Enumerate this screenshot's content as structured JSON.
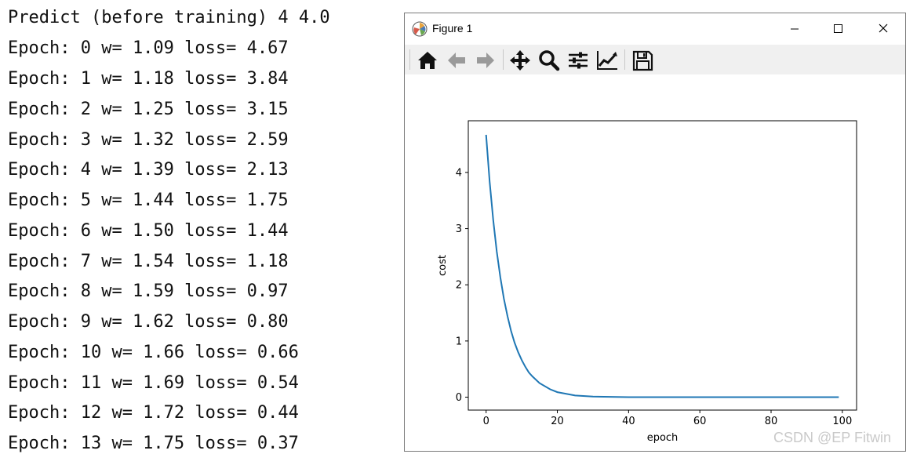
{
  "console": {
    "lines": [
      "Predict (before training) 4 4.0",
      "Epoch: 0 w= 1.09 loss= 4.67",
      "Epoch: 1 w= 1.18 loss= 3.84",
      "Epoch: 2 w= 1.25 loss= 3.15",
      "Epoch: 3 w= 1.32 loss= 2.59",
      "Epoch: 4 w= 1.39 loss= 2.13",
      "Epoch: 5 w= 1.44 loss= 1.75",
      "Epoch: 6 w= 1.50 loss= 1.44",
      "Epoch: 7 w= 1.54 loss= 1.18",
      "Epoch: 8 w= 1.59 loss= 0.97",
      "Epoch: 9 w= 1.62 loss= 0.80",
      "Epoch: 10 w= 1.66 loss= 0.66",
      "Epoch: 11 w= 1.69 loss= 0.54",
      "Epoch: 12 w= 1.72 loss= 0.44",
      "Epoch: 13 w= 1.75 loss= 0.37"
    ]
  },
  "window": {
    "title": "Figure 1",
    "controls": [
      "minimize-icon",
      "maximize-icon",
      "close-icon"
    ]
  },
  "toolbar": {
    "tools": [
      "home-icon",
      "back-icon",
      "forward-icon",
      "pan-icon",
      "zoom-icon",
      "configure-subplots-icon",
      "edit-axis-icon",
      "save-icon"
    ]
  },
  "chart_data": {
    "type": "line",
    "xlabel": "epoch",
    "ylabel": "cost",
    "xlim": [
      -5,
      104
    ],
    "ylim": [
      -0.23,
      4.92
    ],
    "xticks": [
      0,
      20,
      40,
      60,
      80,
      100
    ],
    "yticks": [
      0,
      1,
      2,
      3,
      4
    ],
    "grid": false,
    "line_color": "#1f77b4",
    "series": [
      {
        "x": [
          0,
          1,
          2,
          3,
          4,
          5,
          6,
          7,
          8,
          9,
          10,
          11,
          12,
          13,
          15,
          18,
          20,
          25,
          30,
          40,
          50,
          60,
          70,
          80,
          90,
          99
        ],
        "values": [
          4.67,
          3.84,
          3.15,
          2.59,
          2.13,
          1.75,
          1.44,
          1.18,
          0.97,
          0.8,
          0.66,
          0.54,
          0.44,
          0.37,
          0.25,
          0.14,
          0.09,
          0.03,
          0.01,
          0.0,
          0.0,
          0.0,
          0.0,
          0.0,
          0.0,
          0.0
        ]
      }
    ]
  },
  "watermark": "CSDN @EP Fitwin"
}
